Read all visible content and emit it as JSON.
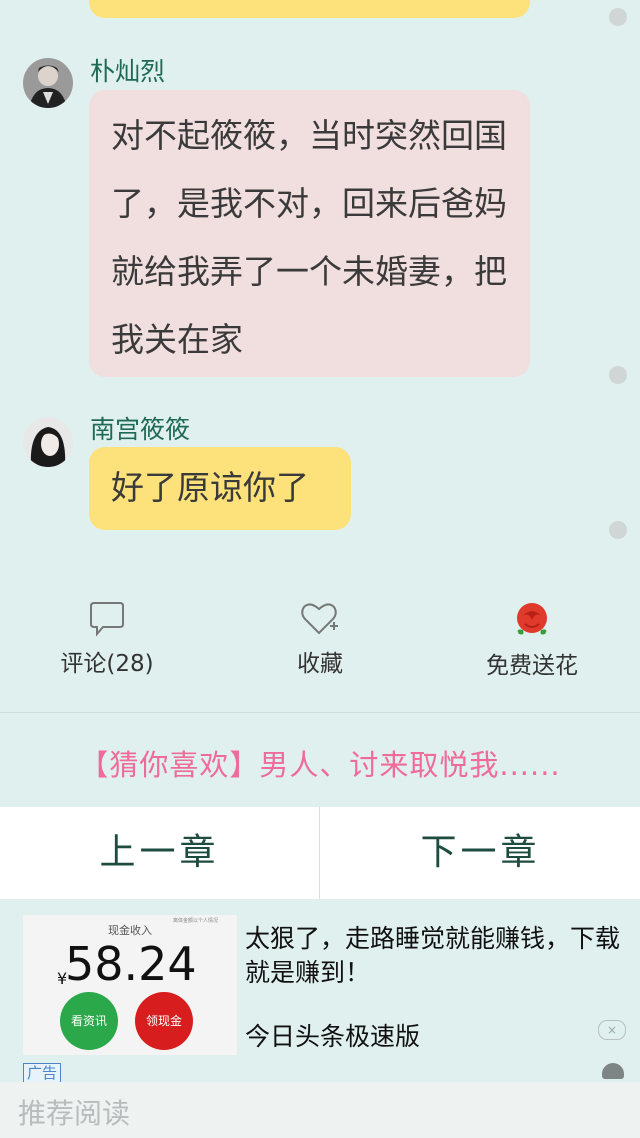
{
  "messages": [
    {
      "speaker": "朴灿烈",
      "text": "对不起筱筱，当时突然回国了，是我不对，回来后爸妈就给我弄了一个未婚妻，把我关在家"
    },
    {
      "speaker": "南宫筱筱",
      "text": "好了原谅你了"
    }
  ],
  "actions": {
    "comment_label": "评论(28)",
    "favorite_label": "收藏",
    "flower_label": "免费送花"
  },
  "recommend_text": "【猜你喜欢】男人、讨来取悦我......",
  "nav": {
    "prev_label": "上一章",
    "next_label": "下一章"
  },
  "ad": {
    "image_title": "现金收入",
    "image_small_note": "离体金额以个人情况",
    "amount": "58.24",
    "currency_symbol": "¥",
    "btn_left": "看资讯",
    "btn_right": "领现金",
    "headline": "太狠了，走路睡觉就能赚钱，下载就是赚到！",
    "source": "今日头条极速版",
    "badge": "广告",
    "close_icon": "×"
  },
  "bottom_label": "推荐阅读",
  "colors": {
    "background": "#dff0ee",
    "bubble_pink": "#f1dedf",
    "bubble_yellow": "#fde17a",
    "name_green": "#1f6a55",
    "recommend_pink": "#ef6c9a",
    "nav_text": "#1e4d40"
  }
}
